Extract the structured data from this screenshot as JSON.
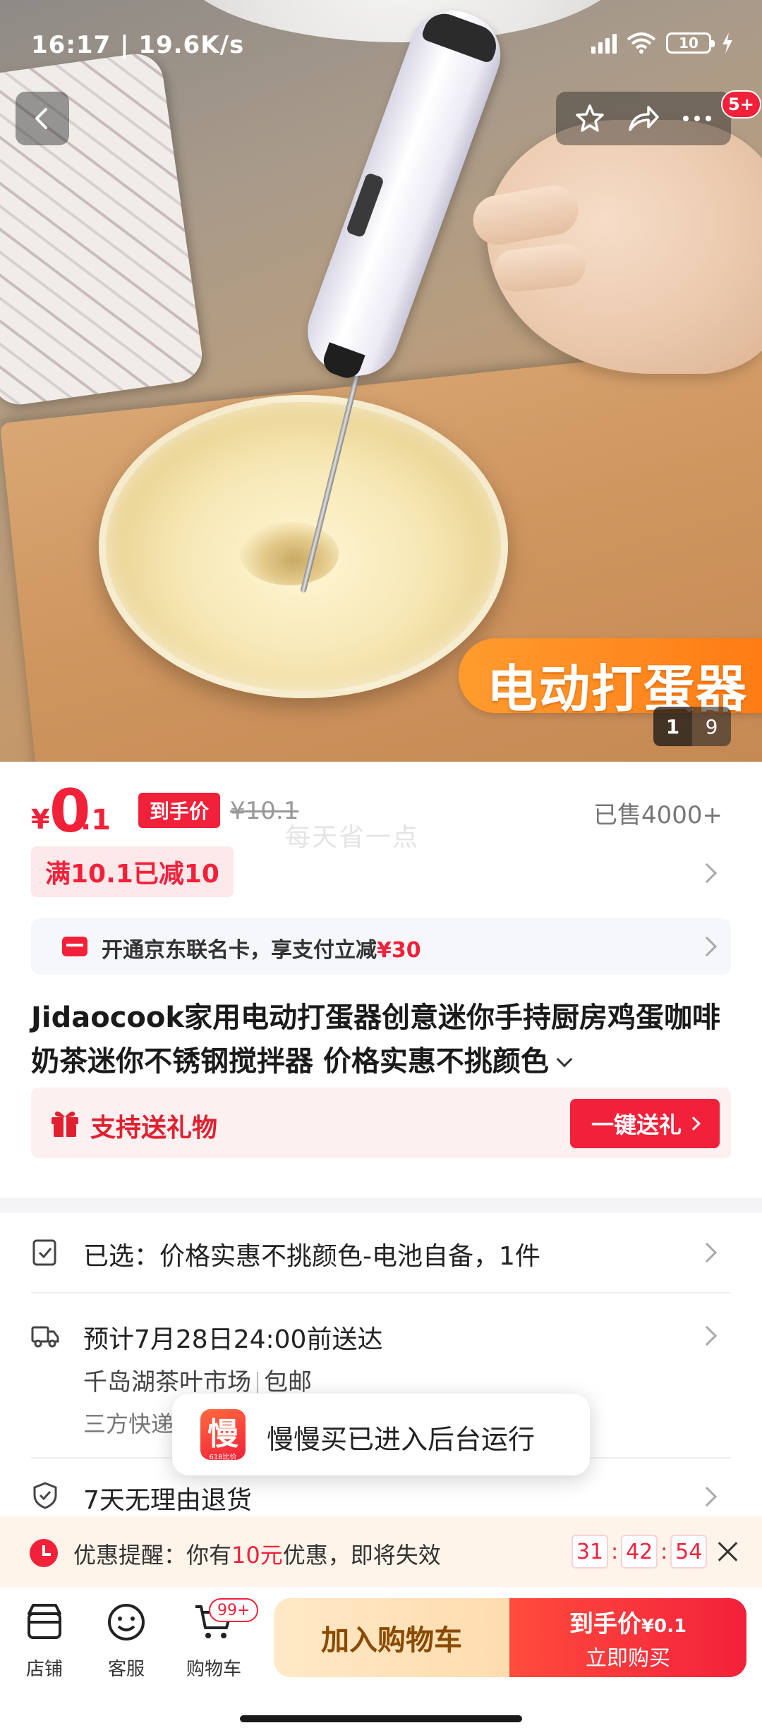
{
  "status_bar": {
    "time_speed": "16:17 | 19.6K/s",
    "battery": "10"
  },
  "top_actions": {
    "notification_badge": "5+"
  },
  "hero": {
    "banner_text": "电动打蛋器",
    "image_index": "1",
    "image_total": "9"
  },
  "price": {
    "currency": "¥",
    "integer": "0",
    "decimal": ".1",
    "final_tag": "到手价",
    "original": "¥10.1",
    "sold": "已售4000+",
    "watermark": "每天省一点"
  },
  "promo": {
    "label": "满10.1已减10"
  },
  "card_offer": {
    "text": "开通京东联名卡，享支付立减",
    "amount": "¥30"
  },
  "product": {
    "title": "Jidaocook家用电动打蛋器创意迷你手持厨房鸡蛋咖啡奶茶迷你不锈钢搅拌器 价格实惠不挑颜色"
  },
  "gift": {
    "label": "支持送礼物",
    "button": "一键送礼"
  },
  "selected": {
    "text": "已选：价格实惠不挑颜色-电池自备，1件"
  },
  "delivery": {
    "eta": "预计7月28日24:00前送达",
    "origin": "千岛湖茶叶市场",
    "shipping": "包邮",
    "carrier": "三方快递"
  },
  "return_policy": {
    "text": "7天无理由退货"
  },
  "toast": {
    "logo_char": "慢",
    "logo_sub": "618比价",
    "message": "慢慢买已进入后台运行"
  },
  "reminder": {
    "prefix": "优惠提醒：你有",
    "amount": "10元",
    "suffix": "优惠，即将失效",
    "hh": "31",
    "mm": "42",
    "ss": "54"
  },
  "bottom_bar": {
    "shop": "店铺",
    "service": "客服",
    "cart": "购物车",
    "cart_badge": "99+",
    "add_to_cart": "加入购物车",
    "buy_line1": "到手价",
    "buy_price": "¥0.1",
    "buy_line2": "立即购买"
  },
  "colors": {
    "accent_red": "#f2213a",
    "promo_bg": "#fde8ea",
    "cart_button": "#ffdcae"
  }
}
